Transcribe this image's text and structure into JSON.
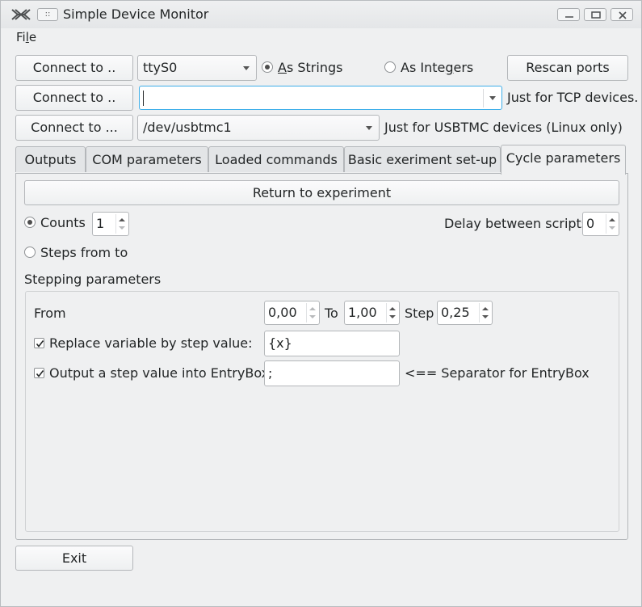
{
  "window": {
    "title": "Simple Device Monitor",
    "menu_button_glyph": "::",
    "controls": [
      "minimize-icon",
      "maximize-icon",
      "close-icon"
    ]
  },
  "menubar": {
    "file_prefix": "Fi",
    "file_underlined": "l",
    "file_suffix": "e"
  },
  "connection": {
    "row1": {
      "connect_label": "Connect to ..",
      "port_value": "ttyS0",
      "as_strings_underlined": "A",
      "as_strings_rest": "s Strings",
      "as_strings_selected": true,
      "as_integers_prefix": "As Inte",
      "as_integers_underlined": "g",
      "as_integers_suffix": "ers",
      "as_integers_selected": false,
      "rescan_label": "Rescan ports"
    },
    "row2": {
      "connect_label": "Connect to ..",
      "tcp_value": "",
      "hint": "Just for TCP devices."
    },
    "row3": {
      "connect_label": "Connect to ...",
      "usbtmc_value": "/dev/usbtmc1",
      "hint": "Just for USBTMC devices (Linux only)"
    }
  },
  "tabs": [
    {
      "label": "Outputs",
      "active": false
    },
    {
      "label": "COM parameters",
      "active": false
    },
    {
      "label": "Loaded commands",
      "active": false
    },
    {
      "label": "Basic exeriment set-up",
      "active": false
    },
    {
      "label": "Cycle parameters",
      "active": true
    }
  ],
  "cycle": {
    "return_label": "Return to experiment",
    "counts_label": "Counts",
    "counts_selected": true,
    "counts_value": "1",
    "delay_label": "Delay between scripts",
    "delay_value": "0",
    "steps_label": "Steps from to",
    "steps_selected": false,
    "stepping_title": "Stepping parameters",
    "from_label": "From",
    "from_value": "0,00",
    "to_label": "To",
    "to_value": "1,00",
    "step_label": "Step",
    "step_value": "0,25",
    "replace_label": "Replace variable by step value:",
    "replace_checked": true,
    "replace_value": "{x}",
    "output_label": "Output a step value into EntryBox",
    "output_checked": true,
    "separator_value": ";",
    "separator_hint": "<== Separator for EntryBox"
  },
  "footer": {
    "exit_label": "Exit"
  },
  "colors": {
    "background": "#eff0f1",
    "focus": "#3daee9",
    "text": "#232627"
  }
}
